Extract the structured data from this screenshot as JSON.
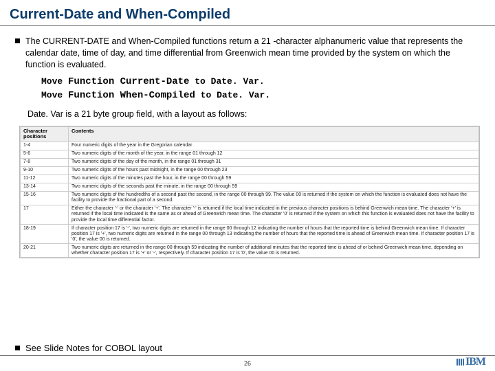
{
  "title": "Current-Date and When-Compiled",
  "intro": "The CURRENT-DATE  and When-Compiled functions return a 21 -character alphanumeric value that represents the calendar date, time of day, and time differential from Greenwich mean time provided by the system on which the function is evaluated.",
  "code": {
    "line1": {
      "kw1": "Move ",
      "fn": "Function Current-Date",
      "rest": " to Date. Var."
    },
    "line2": {
      "kw1": "Move ",
      "fn": "Function When-Compiled",
      "rest": " to Date. Var."
    }
  },
  "subnote": "Date. Var is a 21 byte group field, with a layout as follows:",
  "table": {
    "headers": [
      "Character positions",
      "Contents"
    ],
    "rows": [
      [
        "1-4",
        "Four numeric digits of the year in the Gregorian calendar"
      ],
      [
        "5-6",
        "Two numeric digits of the month of the year, in the range 01 through 12"
      ],
      [
        "7-8",
        "Two numeric digits of the day of the month, in the range 01 through 31"
      ],
      [
        "9-10",
        "Two numeric digits of the hours past midnight, in the range 00 through 23"
      ],
      [
        "11-12",
        "Two numeric digits of the minutes past the hour, in the range 00 through 59"
      ],
      [
        "13-14",
        "Two numeric digits of the seconds past the minute, in the range 00 through 59"
      ],
      [
        "15-16",
        "Two numeric digits of the hundredths of a second past the second, in the range 00 through 99. The value 00 is returned if the system on which the function is evaluated does not have the facility to provide the fractional part of a second."
      ],
      [
        "17",
        "Either the character '-' or the character '+'. The character '-' is returned if the local time indicated in the previous character positions is behind Greenwich mean time. The character '+' is returned if the local time indicated is the same as or ahead of Greenwich mean time. The character '0' is returned if the system on which this function is evaluated does not have the facility to provide the local time differential factor."
      ],
      [
        "18-19",
        "If character position 17 is '-', two numeric digits are returned in the range 00 through 12 indicating the number of hours that the reported time is behind Greenwich mean time. If character position 17 is '+', two numeric digits are returned in the range 00 through 13 indicating the number of hours that the reported time is ahead of Greenwich mean time. If character position 17 is '0', the value 00 is returned."
      ],
      [
        "20-21",
        "Two numeric digits are returned in the range 00 through 59 indicating the number of additional minutes that the reported time is ahead of or behind Greenwich mean time, depending on whether character position 17 is '+' or '-', respectively. If character position 17 is '0', the value 00 is returned."
      ]
    ]
  },
  "footer_note": "See Slide Notes for COBOL layout",
  "page_number": "26",
  "logo_text": "IBM"
}
